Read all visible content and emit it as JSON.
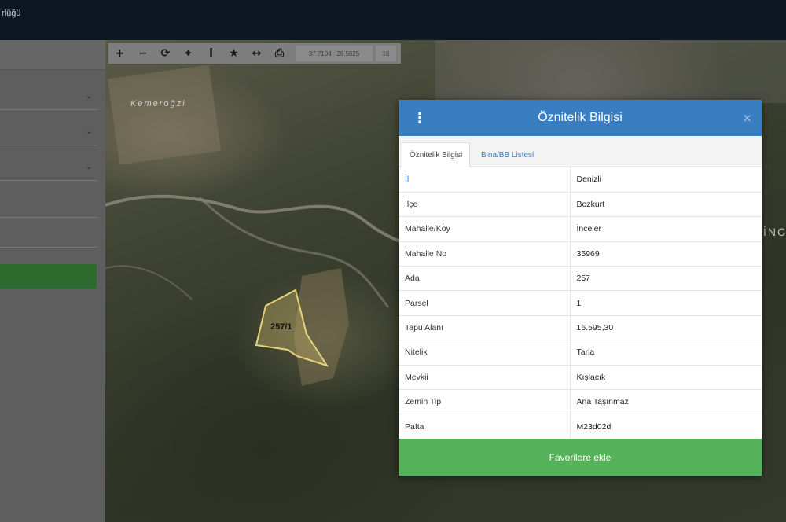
{
  "topbar": {
    "title": "rlüğü"
  },
  "toolbar": {
    "tools": [
      {
        "name": "zoom-in",
        "glyph": "+"
      },
      {
        "name": "zoom-out",
        "glyph": "−"
      },
      {
        "name": "refresh",
        "glyph": "⟳"
      },
      {
        "name": "locate",
        "glyph": "⌖"
      },
      {
        "name": "info",
        "glyph": "i"
      },
      {
        "name": "favorite",
        "glyph": "★"
      },
      {
        "name": "measure",
        "glyph": "↔"
      },
      {
        "name": "print",
        "glyph": "⎙"
      }
    ],
    "coordinates": "37.7104 : 29.5625",
    "zoom_level": "16"
  },
  "map": {
    "place_labels": [
      "Kemeroğzi",
      "İNC"
    ],
    "parcel_label": "257/1"
  },
  "modal": {
    "title": "Öznitelik Bilgisi",
    "close": "×",
    "menu_icon": "⋮",
    "tabs": [
      "Öznitelik Bilgisi",
      "Bina/BB Listesi"
    ],
    "rows": [
      {
        "key": "İl",
        "value": "Denizli"
      },
      {
        "key": "İlçe",
        "value": "Bozkurt"
      },
      {
        "key": "Mahalle/Köy",
        "value": "İnceler"
      },
      {
        "key": "Mahalle No",
        "value": "35969"
      },
      {
        "key": "Ada",
        "value": "257"
      },
      {
        "key": "Parsel",
        "value": "1"
      },
      {
        "key": "Tapu Alanı",
        "value": "16.595,30"
      },
      {
        "key": "Nitelik",
        "value": "Tarla"
      },
      {
        "key": "Mevkii",
        "value": "Kışlacık"
      },
      {
        "key": "Zemin Tip",
        "value": "Ana Taşınmaz"
      },
      {
        "key": "Pafta",
        "value": "M23d02d"
      }
    ],
    "favorite_button": "Favorilere ekle"
  },
  "colors": {
    "header_blue": "#3a7ec2",
    "favorite_green": "#55b25a",
    "topbar": "#0d1621"
  }
}
